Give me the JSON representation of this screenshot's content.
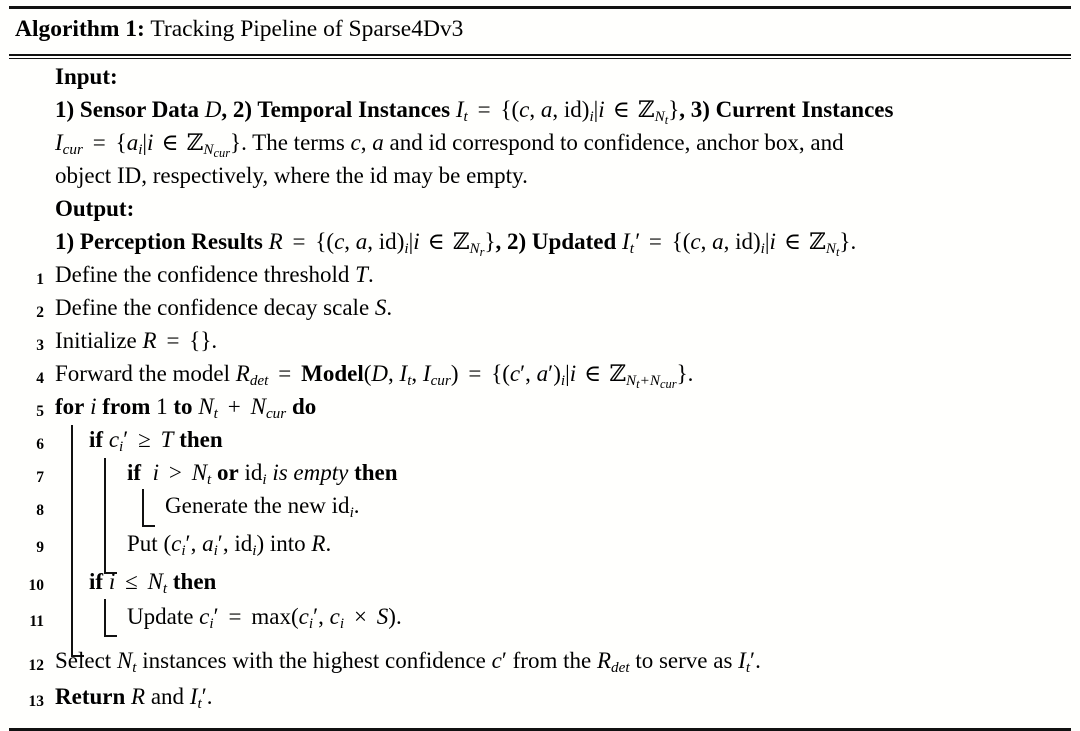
{
  "document": {
    "type": "algorithm-pseudocode",
    "caption_prefix": "Algorithm 1:",
    "caption_title": "Tracking Pipeline of Sparse4Dv3",
    "background_color": "#fffffd",
    "text_color": "#000000",
    "rule_color": "#111111"
  },
  "header": {
    "input_label": "Input:",
    "output_label": "Output:",
    "input_lines": [
      "1) Sensor Data D, 2) Temporal Instances I_t = {(c, a, id)_i | i ∈ ℤ_{N_t}}, 3) Current Instances",
      "I_cur = {a_i | i ∈ ℤ_{N_cur}}. The terms c, a and id correspond to confidence, anchor box, and",
      "object ID, respectively, where the id may be empty."
    ],
    "output_lines": [
      "1) Perception Results R = {(c, a, id)_i | i ∈ ℤ_{N_r}}, 2) Updated I'_t = {(c, a, id)_i | i ∈ ℤ_{N_t}}."
    ]
  },
  "lines": [
    {
      "number": "1",
      "indent": 0,
      "text": "Define the confidence threshold T."
    },
    {
      "number": "2",
      "indent": 0,
      "text": "Define the confidence decay scale S."
    },
    {
      "number": "3",
      "indent": 0,
      "text": "Initialize R = {}."
    },
    {
      "number": "4",
      "indent": 0,
      "text": "Forward the model R_det = Model(D, I_t, I_cur) = {(c', a')_i | i ∈ ℤ_{N_t+N_cur}}."
    },
    {
      "number": "5",
      "indent": 0,
      "text": "for i from 1 to N_t + N_cur do"
    },
    {
      "number": "6",
      "indent": 1,
      "text": "if c'_i ≥ T then"
    },
    {
      "number": "7",
      "indent": 2,
      "text": "if i > N_t or id_i is empty then"
    },
    {
      "number": "8",
      "indent": 3,
      "text": "Generate the new id_i."
    },
    {
      "number": "9",
      "indent": 2,
      "text": "Put (c'_i, a'_i, id_i) into R."
    },
    {
      "number": "10",
      "indent": 1,
      "text": "if i ≤ N_t then"
    },
    {
      "number": "11",
      "indent": 2,
      "text": "Update c'_i = max(c'_i, c_i × S)."
    },
    {
      "number": "12",
      "indent": 0,
      "text": "Select N_t instances with the highest confidence c' from the R_det to serve as I'_t."
    },
    {
      "number": "13",
      "indent": 0,
      "text": "Return R and I'_t."
    }
  ],
  "keywords": {
    "for": "for",
    "from": "from",
    "to": "to",
    "do": "do",
    "if": "if",
    "then": "then",
    "or": "or",
    "is_empty": "is empty",
    "return": "Return",
    "model": "Model",
    "max": "max"
  },
  "symbols": {
    "set_of_integers": "ℤ",
    "element_of": "∈",
    "geq": "≥",
    "leq": "≤",
    "gt": ">",
    "times": "×",
    "prime": "′"
  },
  "line_numbers": [
    "1",
    "2",
    "3",
    "4",
    "5",
    "6",
    "7",
    "8",
    "9",
    "10",
    "11",
    "12",
    "13"
  ]
}
